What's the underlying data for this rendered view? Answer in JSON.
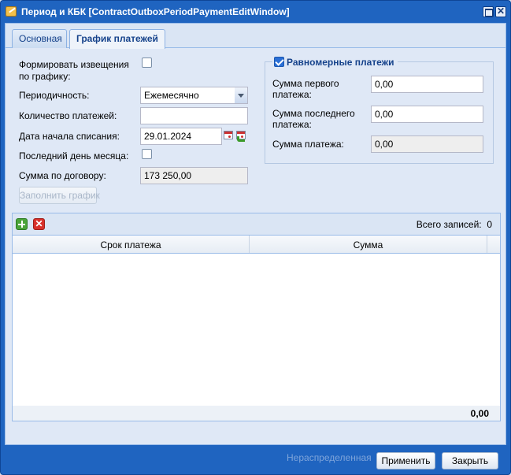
{
  "window": {
    "title": "Период и КБК [ContractOutboxPeriodPaymentEditWindow]"
  },
  "tabs": [
    {
      "label": "Основная"
    },
    {
      "label": "График платежей"
    }
  ],
  "form": {
    "notify_label": "Формировать извещения\nпо графику:",
    "notify_line1": "Формировать извещения",
    "notify_line2": "по графику:",
    "periodicity_label": "Периодичность:",
    "periodicity_value": "Ежемесячно",
    "count_label": "Количество платежей:",
    "count_value": "",
    "start_date_label": "Дата начала списания:",
    "start_date_value": "29.01.2024",
    "last_day_label": "Последний день месяца:",
    "contract_sum_label": "Сумма по договору:",
    "contract_sum_value": "173 250,00",
    "fill_button": "Заполнить график"
  },
  "even_payments": {
    "legend": "Равномерные платежи",
    "checked": true,
    "first_label_1": "Сумма первого",
    "first_label_2": "платежа:",
    "first_value": "0,00",
    "last_label_1": "Сумма последнего",
    "last_label_2": "платежа:",
    "last_value": "0,00",
    "payment_label": "Сумма платежа:",
    "payment_value": "0,00"
  },
  "grid": {
    "total_label": "Всего записей:",
    "total_value": "0",
    "columns": [
      "Срок платежа",
      "Сумма"
    ],
    "summary_sum": "0,00"
  },
  "footer": {
    "ghost_text": "Нераспределенная",
    "apply": "Применить",
    "close": "Закрыть"
  }
}
